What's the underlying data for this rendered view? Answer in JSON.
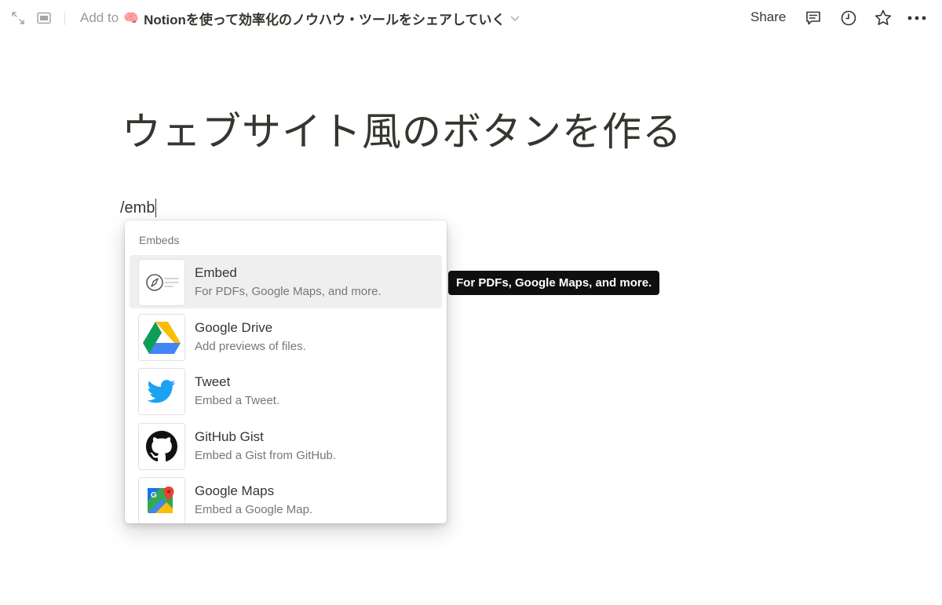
{
  "breadcrumb": {
    "prefix": "Add to",
    "emoji": "🧠",
    "target": "Notionを使って効率化のノウハウ・ツールをシェアしていく"
  },
  "topbar": {
    "share_label": "Share",
    "icons": [
      "expand-icon",
      "sidebar-peek-icon",
      "comment-icon",
      "history-clock-icon",
      "star-icon",
      "more-icon"
    ]
  },
  "page": {
    "title": "ウェブサイト風のボタンを作る",
    "command_text": "/emb"
  },
  "menu": {
    "section_label": "Embeds",
    "items": [
      {
        "title": "Embed",
        "desc": "For PDFs, Google Maps, and more."
      },
      {
        "title": "Google Drive",
        "desc": "Add previews of files."
      },
      {
        "title": "Tweet",
        "desc": "Embed a Tweet."
      },
      {
        "title": "GitHub Gist",
        "desc": "Embed a Gist from GitHub."
      },
      {
        "title": "Google Maps",
        "desc": "Embed a Google Map."
      }
    ]
  },
  "tooltip": {
    "text": "For PDFs, Google Maps, and more."
  },
  "colors": {
    "text": "#37352f",
    "muted": "#787774",
    "hover": "#efefef",
    "tooltip_bg": "#0f0f0f",
    "twitter": "#1da1f2"
  }
}
